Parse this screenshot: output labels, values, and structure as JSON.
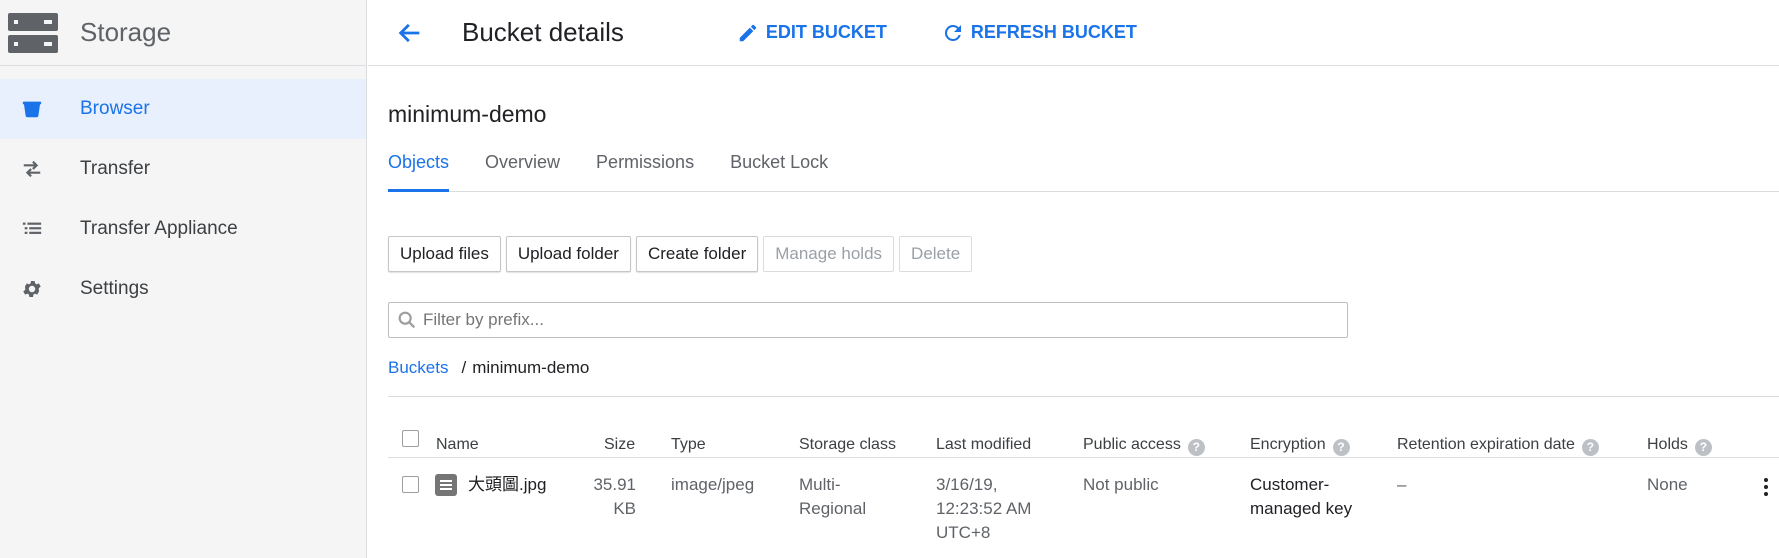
{
  "app": {
    "title": "Storage"
  },
  "sidebar": {
    "items": [
      {
        "label": "Browser",
        "icon": "bucket-icon",
        "active": true
      },
      {
        "label": "Transfer",
        "icon": "swap-arrows-icon",
        "active": false
      },
      {
        "label": "Transfer Appliance",
        "icon": "list-icon",
        "active": false
      },
      {
        "label": "Settings",
        "icon": "gear-icon",
        "active": false
      }
    ]
  },
  "header": {
    "title": "Bucket details",
    "edit_label": "EDIT BUCKET",
    "refresh_label": "REFRESH BUCKET"
  },
  "bucket": {
    "name": "minimum-demo",
    "tabs": [
      {
        "label": "Objects",
        "active": true
      },
      {
        "label": "Overview",
        "active": false
      },
      {
        "label": "Permissions",
        "active": false
      },
      {
        "label": "Bucket Lock",
        "active": false
      }
    ]
  },
  "actions": {
    "upload_files": "Upload files",
    "upload_folder": "Upload folder",
    "create_folder": "Create folder",
    "manage_holds": "Manage holds",
    "delete": "Delete"
  },
  "filter": {
    "placeholder": "Filter by prefix..."
  },
  "breadcrumb": {
    "root": "Buckets",
    "separator": "/",
    "current": "minimum-demo"
  },
  "table": {
    "columns": {
      "name": "Name",
      "size": "Size",
      "type": "Type",
      "storage_class": "Storage class",
      "last_modified": "Last modified",
      "public_access": "Public access",
      "encryption": "Encryption",
      "retention": "Retention expiration date",
      "holds": "Holds"
    },
    "rows": [
      {
        "name": "大頭圖.jpg",
        "size_1": "35.91",
        "size_2": "KB",
        "type": "image/jpeg",
        "storage_class_1": "Multi-",
        "storage_class_2": "Regional",
        "last_modified_1": "3/16/19,",
        "last_modified_2": "12:23:52 AM",
        "last_modified_3": "UTC+8",
        "public_access": "Not public",
        "encryption_1": "Customer-",
        "encryption_2": "managed key",
        "retention": "–",
        "holds": "None"
      }
    ]
  },
  "colors": {
    "accent": "#1a73e8",
    "sidebar_bg": "#f5f5f5",
    "active_bg": "#e8f0fe"
  }
}
